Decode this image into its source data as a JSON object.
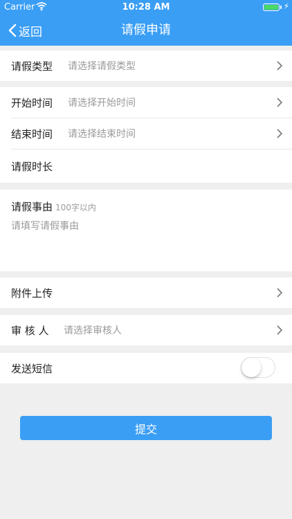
{
  "status_bar": {
    "carrier": "Carrier",
    "time": "10:28 AM"
  },
  "nav": {
    "back_label": "返回",
    "title": "请假申请"
  },
  "form": {
    "leave_type": {
      "label": "请假类型",
      "placeholder": "请选择请假类型"
    },
    "start_time": {
      "label": "开始时间",
      "placeholder": "请选择开始时间"
    },
    "end_time": {
      "label": "结束时间",
      "placeholder": "请选择结束时间"
    },
    "duration": {
      "label": "请假时长",
      "value": ""
    },
    "reason": {
      "label": "请假事由",
      "hint": "100字以内",
      "placeholder": "请填写请假事由",
      "value": ""
    },
    "attachment": {
      "label": "附件上传"
    },
    "approver": {
      "label": "审 核 人",
      "placeholder": "请选择审核人"
    },
    "sms": {
      "label": "发送短信",
      "enabled": false
    }
  },
  "submit_label": "提交",
  "colors": {
    "accent": "#3a9ef5",
    "background": "#efefef",
    "battery": "#4cd964"
  },
  "icons": [
    "wifi-icon",
    "battery-icon",
    "charging-icon",
    "back-chevron-icon",
    "chevron-right-icon"
  ]
}
